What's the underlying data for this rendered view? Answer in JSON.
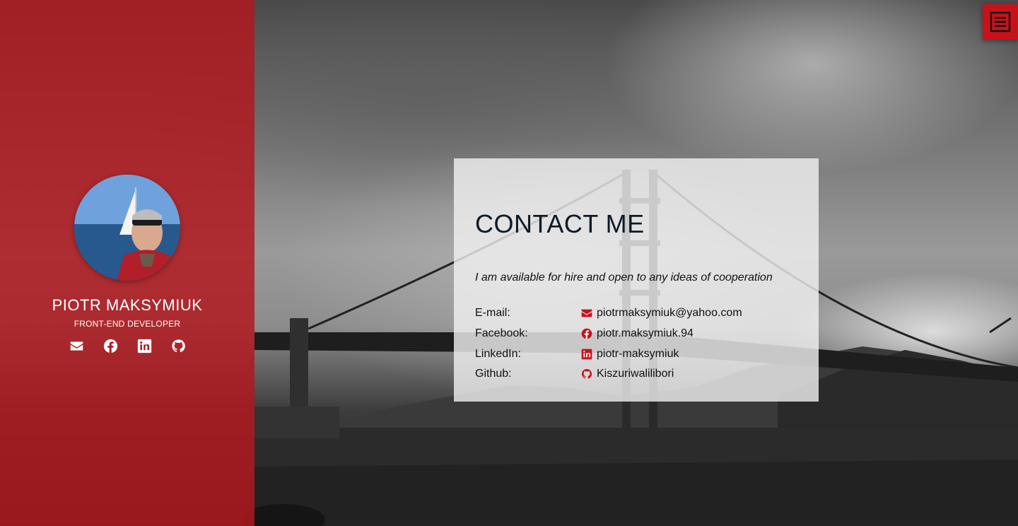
{
  "colors": {
    "accent": "#c8121b",
    "sidebar": "#b2181e",
    "card_text": "#0d1a26"
  },
  "profile": {
    "name": "PIOTR MAKSYMIUK",
    "role": "FRONT-END DEVELOPER",
    "avatar_icon": "profile-photo"
  },
  "socials": [
    {
      "icon": "envelope-icon"
    },
    {
      "icon": "facebook-icon"
    },
    {
      "icon": "linkedin-icon"
    },
    {
      "icon": "github-icon"
    }
  ],
  "menu": {
    "icon": "hamburger-menu-icon"
  },
  "contact": {
    "title": "CONTACT ME",
    "intro": "I am available for hire and open to any ideas of cooperation",
    "rows": [
      {
        "label": "E-mail:",
        "value": "piotrmaksymiuk@yahoo.com",
        "icon": "envelope-icon"
      },
      {
        "label": "Facebook:",
        "value": "piotr.maksymiuk.94",
        "icon": "facebook-icon"
      },
      {
        "label": "LinkedIn:",
        "value": "piotr-maksymiuk",
        "icon": "linkedin-icon"
      },
      {
        "label": "Github:",
        "value": "Kiszuriwalilibori",
        "icon": "github-icon"
      }
    ]
  }
}
